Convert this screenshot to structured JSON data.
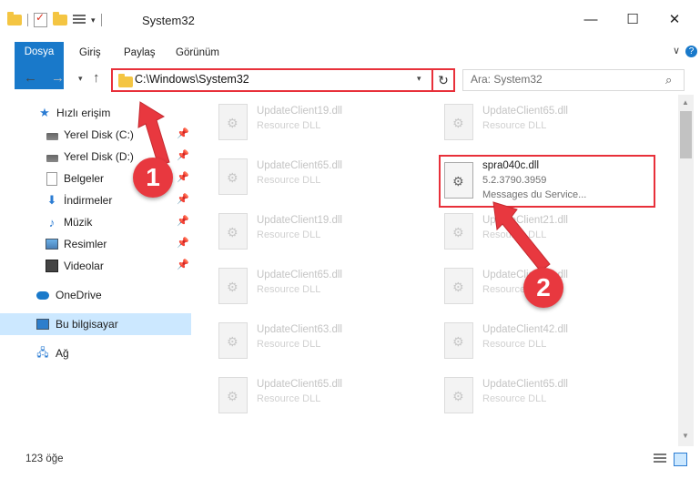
{
  "window": {
    "title": "System32",
    "buttons": {
      "minimize": "—",
      "maximize": "☐",
      "close": "✕"
    }
  },
  "ribbon": {
    "tabs": [
      "Dosya",
      "Giriş",
      "Paylaş",
      "Görünüm"
    ],
    "help": "?"
  },
  "address": {
    "path": "C:\\Windows\\System32",
    "search_placeholder": "Ara: System32",
    "refresh": "↻"
  },
  "sidebar": {
    "items": [
      {
        "label": "Hızlı erişim",
        "icon": "star-icon",
        "pinned": false
      },
      {
        "label": "Yerel Disk (C:)",
        "icon": "drive-icon",
        "pinned": true
      },
      {
        "label": "Yerel Disk (D:)",
        "icon": "drive-icon",
        "pinned": true
      },
      {
        "label": "Belgeler",
        "icon": "document-icon",
        "pinned": true
      },
      {
        "label": "İndirmeler",
        "icon": "download-icon",
        "pinned": true
      },
      {
        "label": "Müzik",
        "icon": "music-icon",
        "pinned": true
      },
      {
        "label": "Resimler",
        "icon": "pictures-icon",
        "pinned": true
      },
      {
        "label": "Videolar",
        "icon": "video-icon",
        "pinned": true
      },
      {
        "label": "OneDrive",
        "icon": "cloud-icon",
        "pinned": false
      },
      {
        "label": "Bu bilgisayar",
        "icon": "computer-icon",
        "pinned": false,
        "selected": true
      },
      {
        "label": "Ağ",
        "icon": "network-icon",
        "pinned": false
      }
    ]
  },
  "files": [
    {
      "name": "UpdateClient19.dll",
      "desc": "Resource DLL"
    },
    {
      "name": "UpdateClient65.dll",
      "desc": "Resource DLL"
    },
    {
      "name": "UpdateClient65.dll",
      "desc": "Resource DLL"
    },
    {
      "name": "spra040c.dll",
      "version": "5.2.3790.3959",
      "desc": "Messages du Service...",
      "highlighted": true
    },
    {
      "name": "UpdateClient19.dll",
      "desc": "Resource DLL"
    },
    {
      "name": "UpdateClient21.dll",
      "desc": "Resource DLL"
    },
    {
      "name": "UpdateClient65.dll",
      "desc": "Resource DLL"
    },
    {
      "name": "UpdateClient65.dll",
      "desc": "Resource DLL"
    },
    {
      "name": "UpdateClient63.dll",
      "desc": "Resource DLL"
    },
    {
      "name": "UpdateClient42.dll",
      "desc": "Resource DLL"
    },
    {
      "name": "UpdateClient65.dll",
      "desc": "Resource DLL"
    },
    {
      "name": "UpdateClient65.dll",
      "desc": "Resource DLL"
    }
  ],
  "status": {
    "count": "123 öğe"
  },
  "annotations": {
    "step1": "1",
    "step2": "2"
  },
  "colors": {
    "accent": "#1979ca",
    "highlight": "#e8303a",
    "selected_bg": "#cce8ff"
  }
}
